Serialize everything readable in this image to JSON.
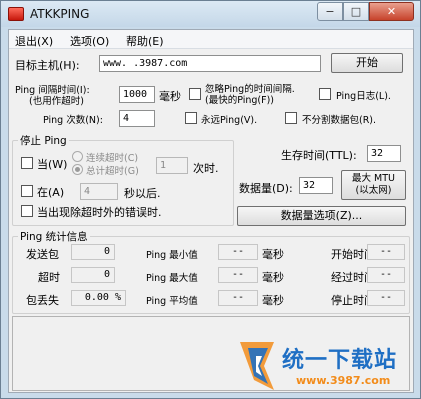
{
  "window": {
    "title": "ATKKPING",
    "min_glyph": "−",
    "max_glyph": "□",
    "close_glyph": "✕"
  },
  "menu": [
    "退出(X)",
    "选项(O)",
    "帮助(E)"
  ],
  "target": {
    "label": "目标主机(H):",
    "value": "www. .3987.com",
    "start_label": "开始"
  },
  "interval": {
    "label_line1": "Ping 间隔时间(I):",
    "label_line2": "(也用作超时)",
    "value": "1000",
    "unit": "毫秒"
  },
  "ignore_interval": {
    "label_line1": "忽略Ping的时间间隔.",
    "label_line2": "(最快的Ping(F))"
  },
  "ping_log_label": "Ping日志(L).",
  "ping_count": {
    "label": "Ping 次数(N):",
    "value": "4"
  },
  "forever_label": "永远Ping(V).",
  "no_fragment_label": "不分割数据包(R).",
  "stop": {
    "title": "停止 Ping",
    "when_label": "当(W)",
    "consecutive_timeout_label": "连续超时(C)",
    "total_timeout_label": "总计超时(G)",
    "timeout_value": "1",
    "times_label": "次时.",
    "at_label": "在(A)",
    "seconds_value": "4",
    "seconds_after_label": "秒以后.",
    "non_timeout_error_label": "当出现除超时外的错误时."
  },
  "ttl": {
    "label": "生存时间(TTL):",
    "value": "32"
  },
  "data_size": {
    "label": "数据量(D):",
    "value": "32"
  },
  "max_mtu": {
    "line1": "最大 MTU",
    "line2": "(以太网)"
  },
  "data_options_label": "数据量选项(Z)...",
  "stats": {
    "title": "Ping  统计信息",
    "rows": [
      [
        {
          "label": "发送包",
          "value": "0"
        },
        {
          "label": "Ping 最小值",
          "value": "--",
          "unit": "毫秒"
        },
        {
          "label": "开始时间",
          "value": "--"
        }
      ],
      [
        {
          "label": "超时",
          "value": "0"
        },
        {
          "label": "Ping 最大值",
          "value": "--",
          "unit": "毫秒"
        },
        {
          "label": "经过时间",
          "value": "--"
        }
      ],
      [
        {
          "label": "包丢失",
          "value": "0.00 %"
        },
        {
          "label": "Ping 平均值",
          "value": "--",
          "unit": "毫秒"
        },
        {
          "label": "停止时间",
          "value": "--"
        }
      ]
    ]
  },
  "watermark": {
    "brand": "统一下载站",
    "url": "www.3987.com"
  },
  "colors": {
    "title_bg": "#c9dbea",
    "close_button": "#c7432b",
    "logo_orange": "#f28c1b",
    "logo_blue": "#1f6fc4"
  }
}
